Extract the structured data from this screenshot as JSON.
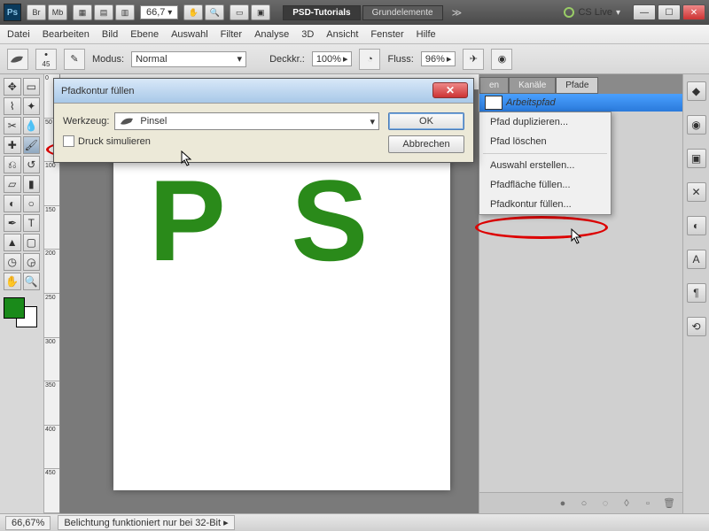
{
  "titlebar": {
    "zoom": "66,7",
    "doc_tabs": [
      "PSD-Tutorials",
      "Grundelemente"
    ],
    "cslive": "CS Live"
  },
  "menu": [
    "Datei",
    "Bearbeiten",
    "Bild",
    "Ebene",
    "Auswahl",
    "Filter",
    "Analyse",
    "3D",
    "Ansicht",
    "Fenster",
    "Hilfe"
  ],
  "options": {
    "brush_size": "45",
    "mode_label": "Modus:",
    "mode_value": "Normal",
    "opacity_label": "Deckkr.:",
    "opacity_value": "100%",
    "flow_label": "Fluss:",
    "flow_value": "96%"
  },
  "canvas_text": "P S",
  "ruler_v": [
    "0",
    "50",
    "100",
    "150",
    "200",
    "250",
    "300",
    "350",
    "400",
    "450"
  ],
  "panel": {
    "tabs": [
      "en",
      "Kanäle",
      "Pfade"
    ],
    "path_name": "Arbeitspfad"
  },
  "context_menu": {
    "items": [
      "Pfad duplizieren...",
      "Pfad löschen",
      "Auswahl erstellen...",
      "Pfadfläche füllen...",
      "Pfadkontur füllen..."
    ]
  },
  "dialog": {
    "title": "Pfadkontur füllen",
    "tool_label": "Werkzeug:",
    "tool_value": "Pinsel",
    "simulate_label": "Druck simulieren",
    "ok": "OK",
    "cancel": "Abbrechen"
  },
  "status": {
    "zoom": "66,67%",
    "msg": "Belichtung funktioniert nur bei 32-Bit"
  }
}
